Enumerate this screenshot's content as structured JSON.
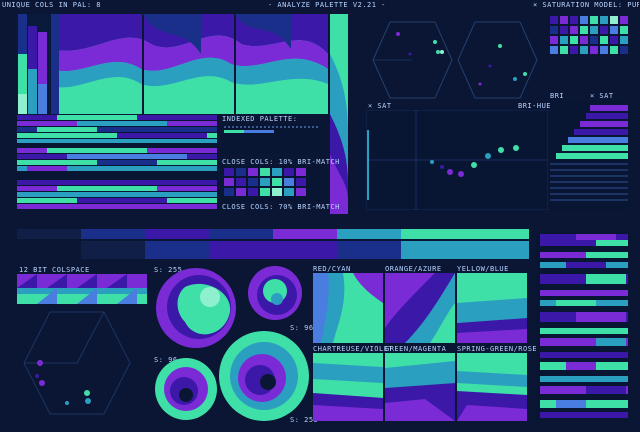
{
  "header": {
    "left": "UNIQUE COLS IN PAL: 8",
    "title": "- ANALYZE PALETTE V2.21 -",
    "right": "× SATURATION MODEL: PURITY"
  },
  "labels": {
    "indexed_palette": "INDEXED PALETTE:",
    "close_cols_1": "CLOSE COLS: 10% BRI-MATCH",
    "close_cols_2": "CLOSE COLS: 70% BRI-MATCH",
    "sat_x": "× SAT",
    "bri_hue": "BRI-HUE",
    "bri": "BRI",
    "sat_x2": "× SAT",
    "colspace": "12 BIT COLSPACE",
    "s255_a": "S: 255",
    "s96_a": "S: 96",
    "s96_b": "S: 96",
    "s255_b": "S: 255",
    "red_cyan": "RED/CYAN",
    "orange_azure": "ORANGE/AZURE",
    "yellow_blue": "YELLOW/BLUE",
    "chartreuse_violet": "CHARTREUSE/VIOLET",
    "green_magenta": "GREEN/MAGENTA",
    "spring_rose": "SPRING-GREEN/ROSE"
  },
  "palette": {
    "colors": [
      "#0b1b3a",
      "#1a2f8a",
      "#3b18a8",
      "#7b2bd6",
      "#4a7de0",
      "#2a9fc0",
      "#3fe0a8",
      "#8ff0d0"
    ]
  }
}
